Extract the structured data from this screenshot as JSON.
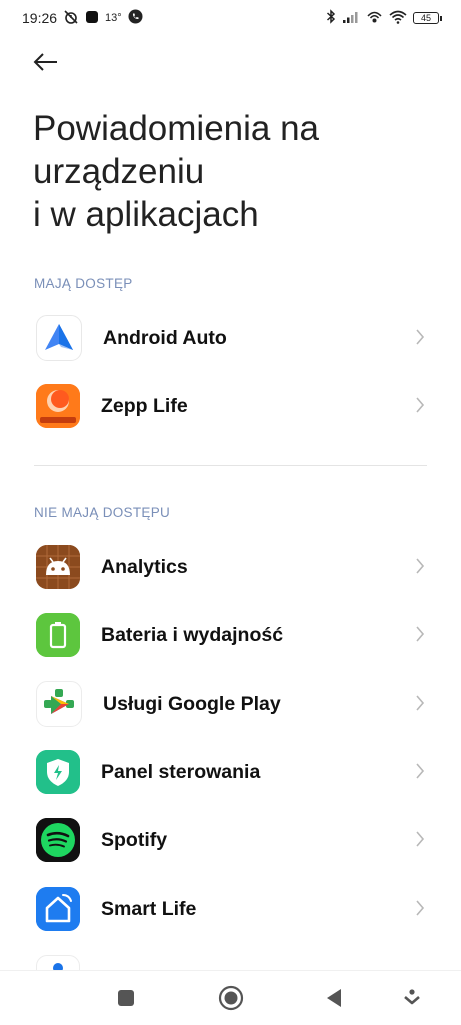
{
  "status_bar": {
    "time": "19:26",
    "temperature": "13°",
    "battery": "45",
    "icons": [
      "alarm-off-icon",
      "app-notification-icon",
      "phone-call-icon",
      "bluetooth-icon",
      "signal-icon",
      "hotspot-icon",
      "wifi-icon",
      "battery-icon"
    ]
  },
  "header": {
    "back_icon": "arrow-left-icon",
    "title_lines": [
      "Powiadomienia na",
      "urządzeniu",
      "i w aplikacjach"
    ]
  },
  "sections": [
    {
      "header": "MAJĄ DOSTĘP",
      "items": [
        {
          "label": "Android Auto",
          "icon": "android-auto-icon"
        },
        {
          "label": "Zepp Life",
          "icon": "zepp-life-icon"
        }
      ]
    },
    {
      "header": "NIE MAJĄ DOSTĘPU",
      "items": [
        {
          "label": "Analytics",
          "icon": "analytics-icon"
        },
        {
          "label": "Bateria i wydajność",
          "icon": "battery-performance-icon"
        },
        {
          "label": "Usługi Google Play",
          "icon": "google-play-services-icon"
        },
        {
          "label": "Panel sterowania",
          "icon": "control-panel-icon"
        },
        {
          "label": "Spotify",
          "icon": "spotify-icon"
        },
        {
          "label": "Smart Life",
          "icon": "smart-life-icon"
        }
      ]
    }
  ],
  "nav_bar": {
    "icons": [
      "recents-square-icon",
      "home-circle-icon",
      "back-triangle-icon",
      "menu-more-icon"
    ]
  },
  "colors": {
    "section_header": "#7a8fb8",
    "chevron": "#b8b8b8",
    "nav_icon": "#555555"
  }
}
